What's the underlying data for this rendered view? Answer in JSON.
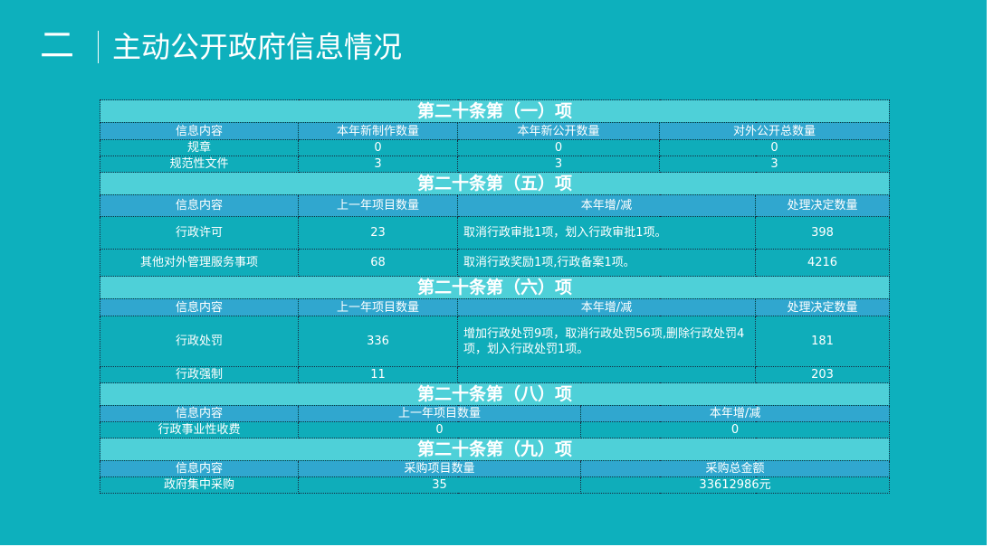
{
  "header": {
    "number": "二",
    "title": "主动公开政府信息情况"
  },
  "s1": {
    "title": "第二十条第（一）项",
    "headers": [
      "信息内容",
      "本年新制作数量",
      "本年新公开数量",
      "对外公开总数量"
    ],
    "rows": [
      [
        "规章",
        "0",
        "0",
        "0"
      ],
      [
        "规范性文件",
        "3",
        "3",
        "3"
      ]
    ]
  },
  "s2": {
    "title": "第二十条第（五）项",
    "headers": [
      "信息内容",
      "上一年项目数量",
      "本年增/减",
      "处理决定数量"
    ],
    "rows": [
      [
        "行政许可",
        "23",
        "取消行政审批1项，划入行政审批1项。",
        "398"
      ],
      [
        "其他对外管理服务事项",
        "68",
        "取消行政奖励1项,行政备案1项。",
        "4216"
      ]
    ]
  },
  "s3": {
    "title": "第二十条第（六）项",
    "headers": [
      "信息内容",
      "上一年项目数量",
      "本年增/减",
      "处理决定数量"
    ],
    "rows": [
      [
        "行政处罚",
        "336",
        "增加行政处罚9项，取消行政处罚56项,删除行政处罚4项，划入行政处罚1项。",
        "181"
      ],
      [
        "行政强制",
        "11",
        "",
        "203"
      ]
    ]
  },
  "s4": {
    "title": "第二十条第（八）项",
    "headers": [
      "信息内容",
      "上一年项目数量",
      "本年增/减"
    ],
    "rows": [
      [
        "行政事业性收费",
        "0",
        "0"
      ]
    ]
  },
  "s5": {
    "title": "第二十条第（九）项",
    "headers": [
      "信息内容",
      "采购项目数量",
      "采购总金额"
    ],
    "rows": [
      [
        "政府集中采购",
        "35",
        "33612986元"
      ]
    ]
  }
}
